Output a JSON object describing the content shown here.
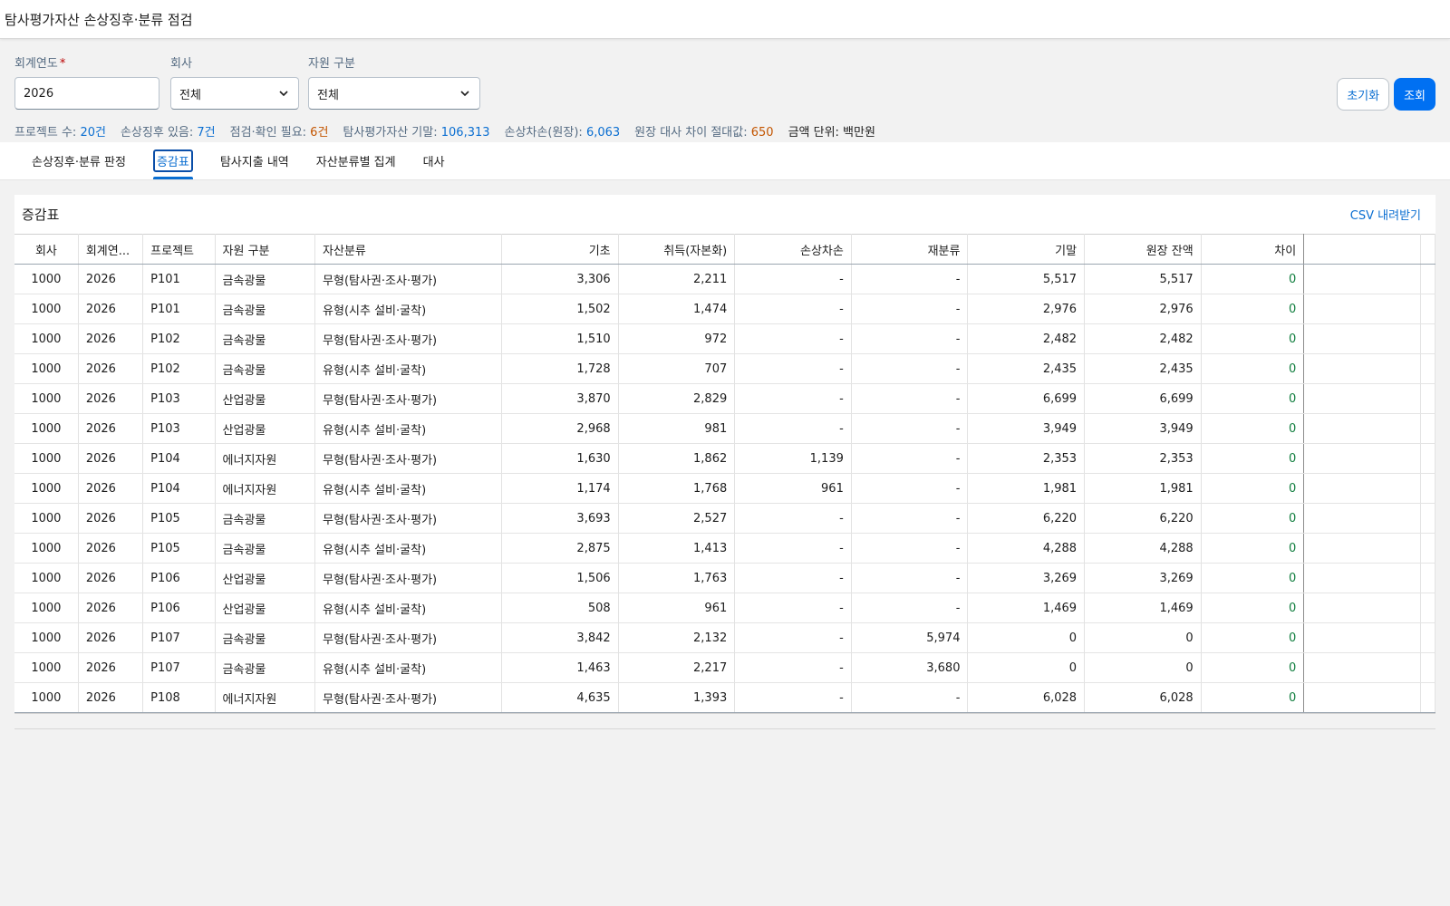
{
  "app": {
    "title": "탐사평가자산 손상징후·분류 점검"
  },
  "filters": {
    "year": {
      "label": "회계연도",
      "required_mark": "*",
      "value": "2026"
    },
    "company": {
      "label": "회사",
      "value": "전체"
    },
    "resource": {
      "label": "자원 구분",
      "value": "전체"
    }
  },
  "buttons": {
    "reset": "초기화",
    "search": "조회"
  },
  "summary": {
    "projects_label": "프로젝트 수:",
    "projects_value": "20건",
    "impair_label": "손상징후 있음:",
    "impair_value": "7건",
    "check_label": "점검·확인 필요:",
    "check_value": "6건",
    "ending_label": "탐사평가자산 기말:",
    "ending_value": "106,313",
    "loss_label": "손상차손(원장):",
    "loss_value": "6,063",
    "diff_label": "원장 대사 차이 절대값:",
    "diff_value": "650",
    "unit": "금액 단위: 백만원"
  },
  "tabs": [
    "손상징후·분류 판정",
    "증감표",
    "탐사지출 내역",
    "자산분류별 집계",
    "대사"
  ],
  "panel": {
    "title": "증감표",
    "csv": "CSV 내려받기"
  },
  "table": {
    "columns": [
      "회사",
      "회계연...",
      "프로젝트",
      "자원 구분",
      "자산분류",
      "기초",
      "취득(자본화)",
      "손상차손",
      "재분류",
      "기말",
      "원장 잔액",
      "차이"
    ],
    "rows": [
      [
        "1000",
        "2026",
        "P101",
        "금속광물",
        "무형(탐사권·조사·평가)",
        "3,306",
        "2,211",
        "-",
        "-",
        "5,517",
        "5,517",
        "0"
      ],
      [
        "1000",
        "2026",
        "P101",
        "금속광물",
        "유형(시추 설비·굴착)",
        "1,502",
        "1,474",
        "-",
        "-",
        "2,976",
        "2,976",
        "0"
      ],
      [
        "1000",
        "2026",
        "P102",
        "금속광물",
        "무형(탐사권·조사·평가)",
        "1,510",
        "972",
        "-",
        "-",
        "2,482",
        "2,482",
        "0"
      ],
      [
        "1000",
        "2026",
        "P102",
        "금속광물",
        "유형(시추 설비·굴착)",
        "1,728",
        "707",
        "-",
        "-",
        "2,435",
        "2,435",
        "0"
      ],
      [
        "1000",
        "2026",
        "P103",
        "산업광물",
        "무형(탐사권·조사·평가)",
        "3,870",
        "2,829",
        "-",
        "-",
        "6,699",
        "6,699",
        "0"
      ],
      [
        "1000",
        "2026",
        "P103",
        "산업광물",
        "유형(시추 설비·굴착)",
        "2,968",
        "981",
        "-",
        "-",
        "3,949",
        "3,949",
        "0"
      ],
      [
        "1000",
        "2026",
        "P104",
        "에너지자원",
        "무형(탐사권·조사·평가)",
        "1,630",
        "1,862",
        "1,139",
        "-",
        "2,353",
        "2,353",
        "0"
      ],
      [
        "1000",
        "2026",
        "P104",
        "에너지자원",
        "유형(시추 설비·굴착)",
        "1,174",
        "1,768",
        "961",
        "-",
        "1,981",
        "1,981",
        "0"
      ],
      [
        "1000",
        "2026",
        "P105",
        "금속광물",
        "무형(탐사권·조사·평가)",
        "3,693",
        "2,527",
        "-",
        "-",
        "6,220",
        "6,220",
        "0"
      ],
      [
        "1000",
        "2026",
        "P105",
        "금속광물",
        "유형(시추 설비·굴착)",
        "2,875",
        "1,413",
        "-",
        "-",
        "4,288",
        "4,288",
        "0"
      ],
      [
        "1000",
        "2026",
        "P106",
        "산업광물",
        "무형(탐사권·조사·평가)",
        "1,506",
        "1,763",
        "-",
        "-",
        "3,269",
        "3,269",
        "0"
      ],
      [
        "1000",
        "2026",
        "P106",
        "산업광물",
        "유형(시추 설비·굴착)",
        "508",
        "961",
        "-",
        "-",
        "1,469",
        "1,469",
        "0"
      ],
      [
        "1000",
        "2026",
        "P107",
        "금속광물",
        "무형(탐사권·조사·평가)",
        "3,842",
        "2,132",
        "-",
        "5,974",
        "0",
        "0",
        "0"
      ],
      [
        "1000",
        "2026",
        "P107",
        "금속광물",
        "유형(시추 설비·굴착)",
        "1,463",
        "2,217",
        "-",
        "3,680",
        "0",
        "0",
        "0"
      ],
      [
        "1000",
        "2026",
        "P108",
        "에너지자원",
        "무형(탐사권·조사·평가)",
        "4,635",
        "1,393",
        "-",
        "-",
        "6,028",
        "6,028",
        "0"
      ]
    ]
  },
  "colors": {
    "accent": "#0a6ed1",
    "primary_button": "#0070f2",
    "warning": "#c35500",
    "positive": "#107e3e"
  }
}
